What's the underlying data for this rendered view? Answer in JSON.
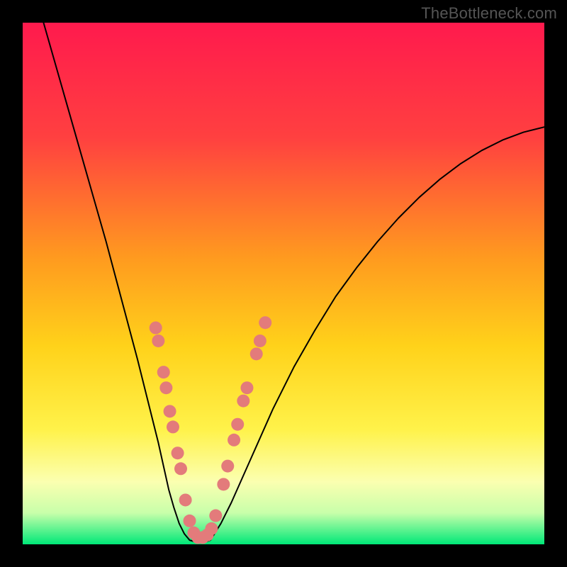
{
  "watermark": "TheBottleneck.com",
  "chart_data": {
    "type": "line",
    "title": "",
    "xlabel": "",
    "ylabel": "",
    "xlim": [
      0,
      100
    ],
    "ylim": [
      0,
      100
    ],
    "background_gradient": {
      "stops": [
        {
          "offset": 0.0,
          "color": "#ff1a4d"
        },
        {
          "offset": 0.22,
          "color": "#ff4040"
        },
        {
          "offset": 0.45,
          "color": "#ff9a1f"
        },
        {
          "offset": 0.62,
          "color": "#ffd21a"
        },
        {
          "offset": 0.78,
          "color": "#fff24a"
        },
        {
          "offset": 0.88,
          "color": "#fbffb0"
        },
        {
          "offset": 0.94,
          "color": "#c8ffaa"
        },
        {
          "offset": 1.0,
          "color": "#00e878"
        }
      ]
    },
    "series": [
      {
        "name": "left-branch",
        "stroke": "#000000",
        "stroke_width": 2.0,
        "x": [
          4.0,
          6.0,
          8.0,
          10.0,
          12.0,
          14.0,
          16.0,
          18.0,
          20.0,
          22.0,
          24.0,
          26.0,
          27.0,
          28.0,
          29.0,
          30.0,
          31.0,
          32.0
        ],
        "y": [
          100.0,
          93.0,
          86.0,
          79.0,
          72.0,
          65.0,
          58.0,
          50.5,
          43.0,
          35.5,
          27.5,
          19.5,
          15.0,
          10.5,
          7.0,
          4.0,
          2.0,
          0.8
        ]
      },
      {
        "name": "valley-floor",
        "stroke": "#000000",
        "stroke_width": 2.0,
        "x": [
          32.0,
          33.0,
          34.0,
          35.0,
          36.0
        ],
        "y": [
          0.8,
          0.5,
          0.4,
          0.5,
          0.8
        ]
      },
      {
        "name": "right-branch",
        "stroke": "#000000",
        "stroke_width": 2.0,
        "x": [
          36.0,
          38.0,
          40.0,
          42.0,
          44.0,
          46.0,
          48.0,
          52.0,
          56.0,
          60.0,
          64.0,
          68.0,
          72.0,
          76.0,
          80.0,
          84.0,
          88.0,
          92.0,
          96.0,
          100.0
        ],
        "y": [
          0.8,
          4.0,
          8.0,
          12.5,
          17.0,
          21.5,
          26.0,
          34.0,
          41.0,
          47.5,
          53.0,
          58.0,
          62.5,
          66.5,
          70.0,
          73.0,
          75.5,
          77.5,
          79.0,
          80.0
        ]
      }
    ],
    "markers": {
      "name": "highlight-dots",
      "fill": "#e37b7b",
      "radius": 9,
      "points": [
        {
          "x": 25.5,
          "y": 41.5
        },
        {
          "x": 26.0,
          "y": 39.0
        },
        {
          "x": 27.0,
          "y": 33.0
        },
        {
          "x": 27.5,
          "y": 30.0
        },
        {
          "x": 28.2,
          "y": 25.5
        },
        {
          "x": 28.8,
          "y": 22.5
        },
        {
          "x": 29.7,
          "y": 17.5
        },
        {
          "x": 30.3,
          "y": 14.5
        },
        {
          "x": 31.2,
          "y": 8.5
        },
        {
          "x": 32.0,
          "y": 4.5
        },
        {
          "x": 32.8,
          "y": 2.2
        },
        {
          "x": 33.6,
          "y": 1.3
        },
        {
          "x": 34.5,
          "y": 1.3
        },
        {
          "x": 35.4,
          "y": 1.8
        },
        {
          "x": 36.2,
          "y": 3.0
        },
        {
          "x": 37.0,
          "y": 5.5
        },
        {
          "x": 38.5,
          "y": 11.5
        },
        {
          "x": 39.3,
          "y": 15.0
        },
        {
          "x": 40.5,
          "y": 20.0
        },
        {
          "x": 41.2,
          "y": 23.0
        },
        {
          "x": 42.3,
          "y": 27.5
        },
        {
          "x": 43.0,
          "y": 30.0
        },
        {
          "x": 44.8,
          "y": 36.5
        },
        {
          "x": 45.5,
          "y": 39.0
        },
        {
          "x": 46.5,
          "y": 42.5
        }
      ]
    }
  }
}
